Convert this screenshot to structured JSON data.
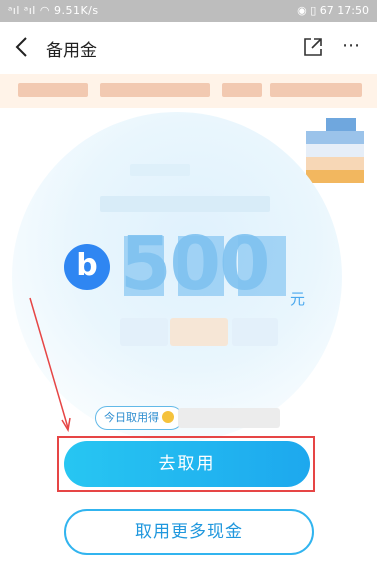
{
  "status_bar": {
    "network_speed": "9.51K/s",
    "battery": "67",
    "time": "17:50"
  },
  "header": {
    "title": "备用金",
    "back_icon": "chevron-left-icon",
    "share_icon": "share-icon",
    "more_icon": "more-horizontal-icon"
  },
  "hero": {
    "logo_letter": "b",
    "amount": "500",
    "unit": "元"
  },
  "tag": {
    "label": "今日取用得"
  },
  "buttons": {
    "primary_label": "去取用",
    "secondary_label": "取用更多现金"
  },
  "colors": {
    "accent": "#1da8ee",
    "highlight": "#e64545"
  }
}
